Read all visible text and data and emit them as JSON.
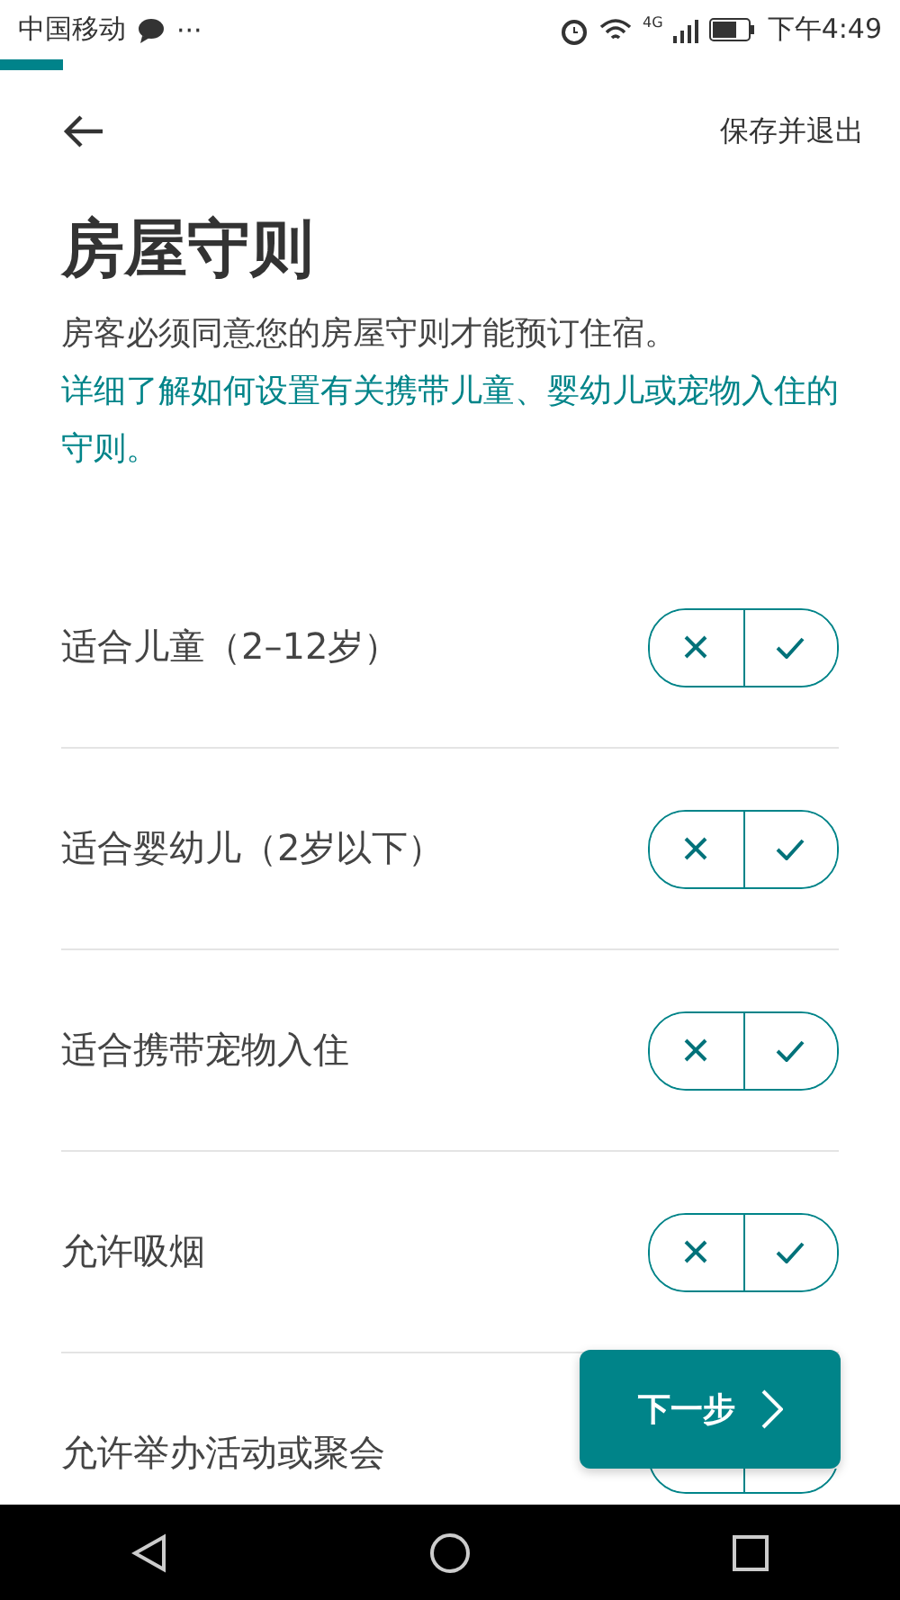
{
  "status_bar": {
    "carrier": "中国移动",
    "more": "···",
    "network": "4G",
    "time": "下午4:49"
  },
  "progress": {
    "level": 0.07
  },
  "header": {
    "save_exit": "保存并退出"
  },
  "title": "房屋守则",
  "description": "房客必须同意您的房屋守则才能预订住宿。",
  "help_link": "详细了解如何设置有关携带儿童、婴幼儿或宠物入住的守则。",
  "rules": [
    {
      "label": "适合儿童（2–12岁）",
      "no_selected": false,
      "yes_selected": false
    },
    {
      "label": "适合婴幼儿（2岁以下）",
      "no_selected": false,
      "yes_selected": false
    },
    {
      "label": "适合携带宠物入住",
      "no_selected": false,
      "yes_selected": false
    },
    {
      "label": "允许吸烟",
      "no_selected": false,
      "yes_selected": false
    },
    {
      "label": "允许举办活动或聚会",
      "no_selected": false,
      "yes_selected": false
    }
  ],
  "next_button": {
    "label": "下一步"
  }
}
